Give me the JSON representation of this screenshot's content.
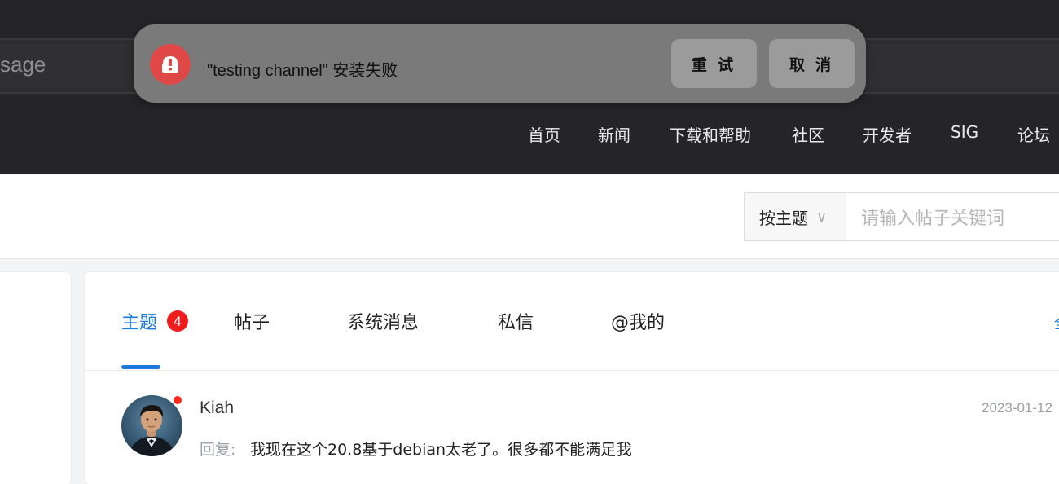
{
  "browser": {
    "url_fragment": "sage"
  },
  "nav": {
    "items": [
      "首页",
      "新闻",
      "下载和帮助",
      "社区",
      "开发者",
      "SIG",
      "论坛"
    ]
  },
  "toast": {
    "icon": "app-install-error-icon",
    "message": "\"testing channel\" 安装失败",
    "retry_label": "重 试",
    "cancel_label": "取 消",
    "accent": "#e04848"
  },
  "filter": {
    "select_value": "按主题",
    "search_placeholder": "请输入帖子关键词"
  },
  "tabs": {
    "items": [
      "主题",
      "帖子",
      "系统消息",
      "私信",
      "@我的"
    ],
    "active_index": 0,
    "badge_count": "4",
    "accent": "#1f7ae0"
  },
  "messages": [
    {
      "author": "Kiah",
      "date": "2023-01-12",
      "reply_label": "回复:",
      "reply_text": "我现在这个20.8基于debian太老了。很多都不能满足我",
      "unread": true
    }
  ]
}
